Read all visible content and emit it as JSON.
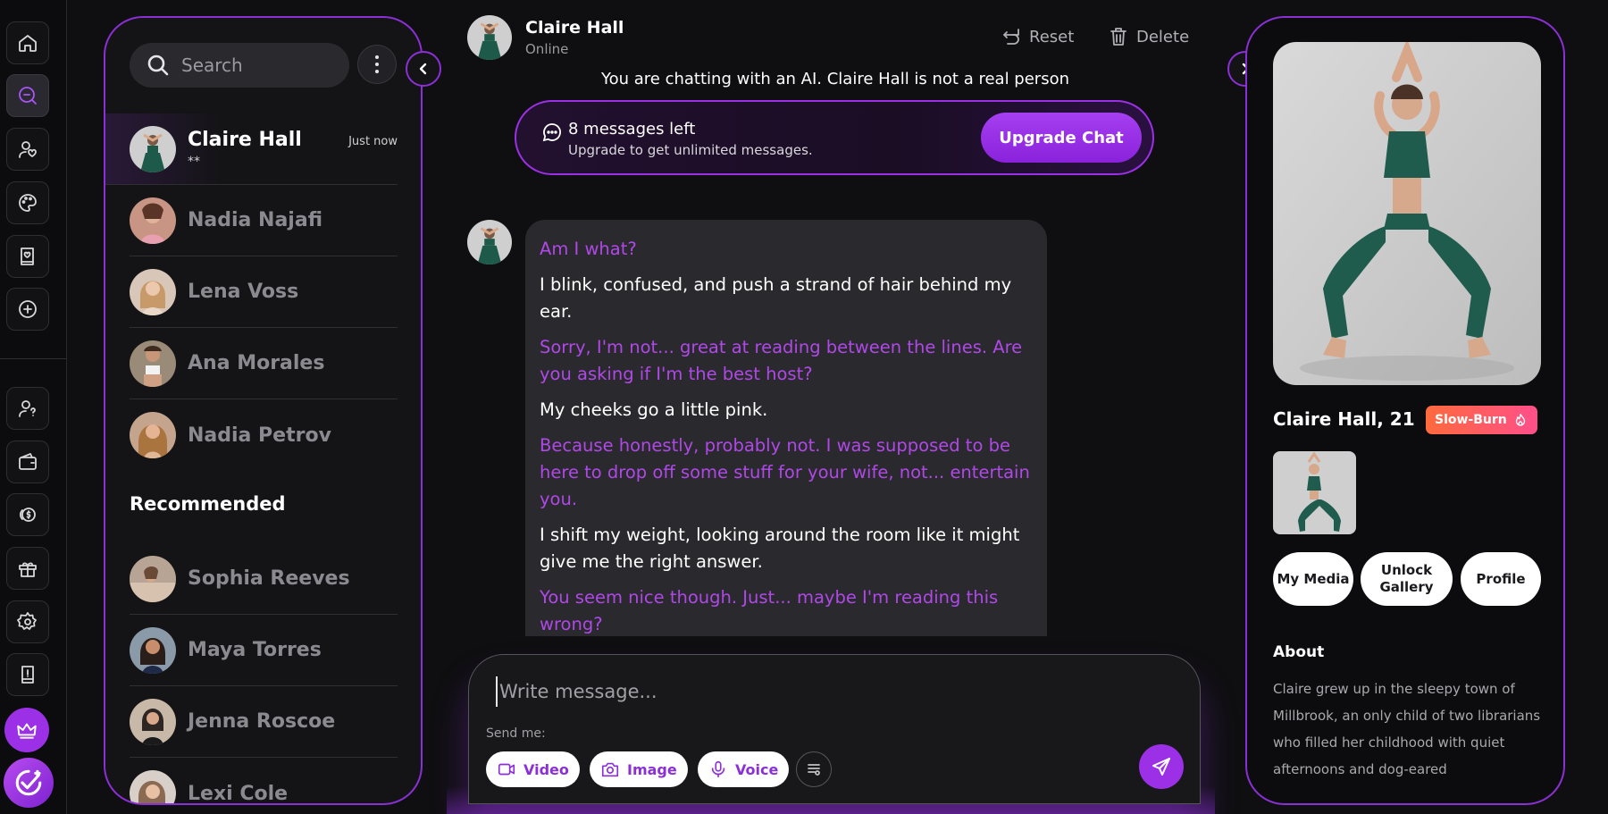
{
  "rail": {
    "icons": [
      "home-icon",
      "chat-icon",
      "user-heart-icon",
      "palette-icon",
      "book-heart-icon",
      "plus-circle-icon",
      "user-question-icon",
      "wallet-icon",
      "coin-icon",
      "gift-icon",
      "settings-icon",
      "guide-icon",
      "crown-icon",
      "check-badge-icon"
    ]
  },
  "sidebar": {
    "search_placeholder": "Search",
    "chats": [
      {
        "name": "Claire Hall",
        "preview": "**",
        "time": "Just now",
        "active": true
      },
      {
        "name": "Nadia Najafi"
      },
      {
        "name": "Lena Voss"
      },
      {
        "name": "Ana Morales"
      },
      {
        "name": "Nadia Petrov"
      }
    ],
    "recommended_title": "Recommended",
    "recommended": [
      {
        "name": "Sophia Reeves"
      },
      {
        "name": "Maya Torres"
      },
      {
        "name": "Jenna Roscoe"
      },
      {
        "name": "Lexi Cole"
      }
    ]
  },
  "conversation": {
    "name": "Claire Hall",
    "status": "Online",
    "reset_label": "Reset",
    "delete_label": "Delete",
    "disclaimer": "You are chatting with an AI. Claire Hall is not a real person",
    "upsell": {
      "count_text": "8 messages left",
      "sub_text": "Upgrade to get unlimited messages.",
      "button_label": "Upgrade Chat"
    },
    "message": [
      {
        "type": "speech",
        "text": "Am I what?"
      },
      {
        "type": "action",
        "text": "I blink, confused, and push a strand of hair behind my ear."
      },
      {
        "type": "speech",
        "text": "Sorry, I'm not... great at reading between the lines. Are you asking if I'm the best host?"
      },
      {
        "type": "action",
        "text": "My cheeks go a little pink."
      },
      {
        "type": "speech",
        "text": "Because honestly, probably not. I was supposed to be here to drop off some stuff for your wife, not... entertain you."
      },
      {
        "type": "action",
        "text": "I shift my weight, looking around the room like it might give me the right answer."
      },
      {
        "type": "speech",
        "text": "You seem nice though. Just... maybe I'm reading this wrong?"
      }
    ]
  },
  "composer": {
    "placeholder": "Write message...",
    "send_me_label": "Send me:",
    "video_label": "Video",
    "image_label": "Image",
    "voice_label": "Voice"
  },
  "profile": {
    "name_age": "Claire Hall, 21",
    "badge": "Slow-Burn",
    "my_media": "My Media",
    "unlock_gallery": "Unlock Gallery",
    "profile_label": "Profile",
    "about_title": "About",
    "about_text": "Claire grew up in the sleepy town of Millbrook, an only child of two librarians who filled her childhood with quiet afternoons and dog-eared"
  },
  "colors": {
    "accent": "#8b2fd6",
    "speech": "#b048e8",
    "badge_start": "#ff6a3d",
    "badge_end": "#ff4f8a"
  }
}
